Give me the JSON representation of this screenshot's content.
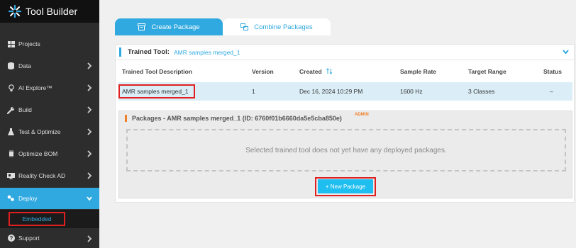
{
  "app": {
    "title": "Tool Builder"
  },
  "sidebar": {
    "items": [
      {
        "label": "Projects",
        "icon": "grid-icon",
        "chevron": false
      },
      {
        "label": "Data",
        "icon": "database-icon",
        "chevron": true
      },
      {
        "label": "AI Explore™",
        "icon": "lightbulb-icon",
        "chevron": true
      },
      {
        "label": "Build",
        "icon": "wrench-icon",
        "chevron": true
      },
      {
        "label": "Test & Optimize",
        "icon": "flask-icon",
        "chevron": true
      },
      {
        "label": "Optimize BOM",
        "icon": "chip-icon",
        "chevron": true
      },
      {
        "label": "Reality Check AD",
        "icon": "monitor-icon",
        "chevron": true
      },
      {
        "label": "Deploy",
        "icon": "deploy-icon",
        "chevron": true,
        "active": true
      },
      {
        "label": "Support",
        "icon": "help-icon",
        "chevron": true
      }
    ],
    "subitems": [
      {
        "label": "Embedded"
      }
    ]
  },
  "tabs": [
    {
      "label": "Create Package",
      "active": true
    },
    {
      "label": "Combine Packages",
      "active": false
    }
  ],
  "trained_tool": {
    "label": "Trained Tool:",
    "value": "AMR samples merged_1"
  },
  "table": {
    "headers": {
      "description": "Trained Tool Description",
      "version": "Version",
      "created": "Created",
      "sample_rate": "Sample Rate",
      "target_range": "Target Range",
      "status": "Status"
    },
    "rows": [
      {
        "description": "AMR samples merged_1",
        "version": "1",
        "created": "Dec 16, 2024 10:29 PM",
        "sample_rate": "1600 Hz",
        "target_range": "3 Classes",
        "status": "–"
      }
    ]
  },
  "packages": {
    "title_prefix": "Packages  - AMR samples merged_1 (",
    "id_label": "ID:",
    "id_value": " 6760f01b6660da5e5cba850e",
    "title_suffix": ")",
    "admin_badge": "ADMIN",
    "empty_message": "Selected trained tool does not yet have any deployed packages.",
    "new_button": "+ New Package"
  },
  "colors": {
    "accent": "#2fa9e0",
    "sidebar_bg": "#2d2d2d",
    "highlight_border": "#e02020",
    "packages_accent": "#f07f2a"
  }
}
